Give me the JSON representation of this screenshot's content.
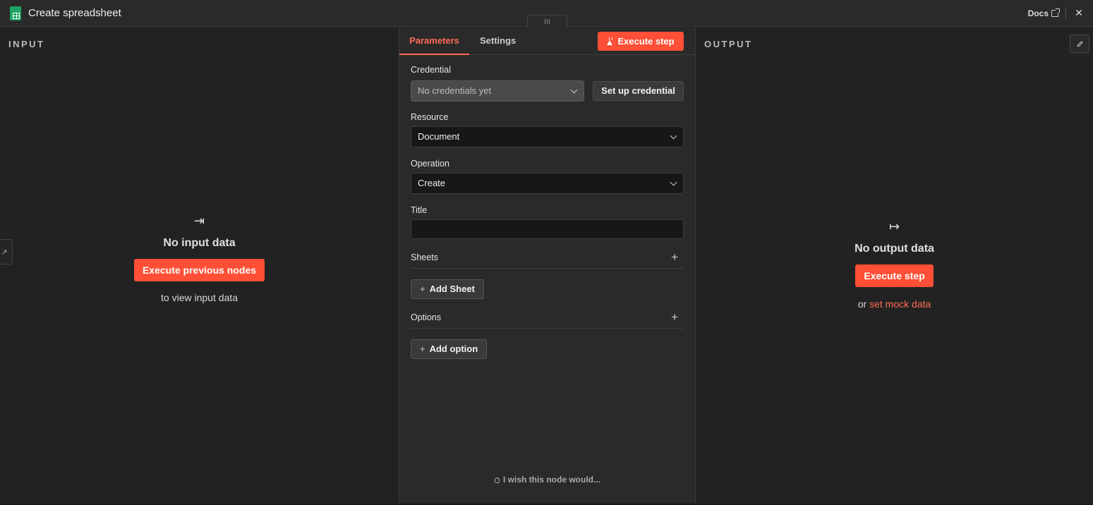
{
  "header": {
    "title": "Create spreadsheet",
    "docs_label": "Docs",
    "close_glyph": "✕"
  },
  "input_panel": {
    "label": "INPUT",
    "empty_icon": "⇥",
    "empty_title": "No input data",
    "execute_label": "Execute previous nodes",
    "subtitle": "to view input data"
  },
  "params_panel": {
    "tabs": [
      {
        "label": "Parameters",
        "active": true
      },
      {
        "label": "Settings",
        "active": false
      }
    ],
    "execute_label": "Execute step",
    "credential": {
      "label": "Credential",
      "value": "No credentials yet",
      "setup_label": "Set up credential"
    },
    "resource": {
      "label": "Resource",
      "value": "Document"
    },
    "operation": {
      "label": "Operation",
      "value": "Create"
    },
    "title_field": {
      "label": "Title",
      "value": ""
    },
    "sheets": {
      "label": "Sheets",
      "add_label": "Add Sheet"
    },
    "options": {
      "label": "Options",
      "add_label": "Add option"
    },
    "wish_label": "I wish this node would..."
  },
  "output_panel": {
    "label": "OUTPUT",
    "empty_icon": "↦",
    "empty_title": "No output data",
    "execute_label": "Execute step",
    "or_text": "or",
    "mock_link": "set mock data"
  },
  "colors": {
    "accent": "#ff4f36",
    "accent_text": "#ff6b54",
    "brand_sheets": "#1ea362"
  }
}
